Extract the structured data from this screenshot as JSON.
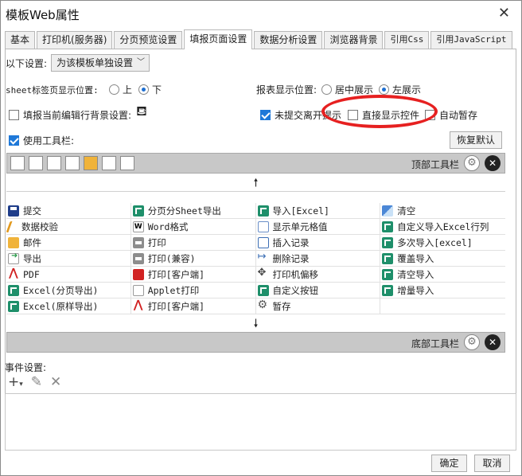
{
  "window": {
    "title": "模板Web属性"
  },
  "tabs": [
    {
      "label": "基本",
      "mono": false
    },
    {
      "label": "打印机(服务器)",
      "mono": false
    },
    {
      "label": "分页预览设置",
      "mono": false
    },
    {
      "label": "填报页面设置",
      "mono": false,
      "active": true
    },
    {
      "label": "数据分析设置",
      "mono": false
    },
    {
      "label": "浏览器背景",
      "mono": false
    },
    {
      "label": "引用Css",
      "mono": true
    },
    {
      "label": "引用JavaScript",
      "mono": true
    }
  ],
  "settings": {
    "scope_label": "以下设置:",
    "scope_value": "为该模板单独设置",
    "sheet_tab_label": "sheet标签页显示位置:",
    "sheet_top": "上",
    "sheet_bottom": "下",
    "report_pos_label": "报表显示位置:",
    "report_center": "居中展示",
    "report_left": "左展示",
    "fill_bg_label": "填报当前编辑行背景设置:",
    "unsubmitted_label": "未提交离开提示",
    "direct_show_label": "直接显示控件",
    "auto_save_label": "自动暂存",
    "use_toolbar_label": "使用工具栏:",
    "restore_default": "恢复默认"
  },
  "toolbar": {
    "top_label": "顶部工具栏",
    "bottom_label": "底部工具栏"
  },
  "grid": [
    [
      {
        "icon": "save",
        "text": "提交"
      },
      {
        "icon": "green",
        "text": "分页分Sheet导出"
      },
      {
        "icon": "green",
        "text": "导入[Excel]"
      },
      {
        "icon": "eraser",
        "text": "清空"
      }
    ],
    [
      {
        "icon": "check",
        "text": "数据校验"
      },
      {
        "icon": "word",
        "text": "Word格式"
      },
      {
        "icon": "cell",
        "text": "显示单元格值"
      },
      {
        "icon": "green",
        "text": "自定义导入Excel行列"
      }
    ],
    [
      {
        "icon": "mail",
        "text": "邮件"
      },
      {
        "icon": "print",
        "text": "打印"
      },
      {
        "icon": "insert",
        "text": "插入记录"
      },
      {
        "icon": "green",
        "text": "多次导入[excel]"
      }
    ],
    [
      {
        "icon": "export",
        "text": "导出"
      },
      {
        "icon": "print",
        "text": "打印(兼容)"
      },
      {
        "icon": "del",
        "text": "删除记录"
      },
      {
        "icon": "green",
        "text": "覆盖导入"
      }
    ],
    [
      {
        "icon": "pdf",
        "text": "PDF"
      },
      {
        "icon": "red",
        "text": "打印[客户端]"
      },
      {
        "icon": "move",
        "text": "打印机偏移"
      },
      {
        "icon": "green",
        "text": "清空导入"
      }
    ],
    [
      {
        "icon": "green",
        "text": "Excel(分页导出)"
      },
      {
        "icon": "applet",
        "text": "Applet打印"
      },
      {
        "icon": "green",
        "text": "自定义按钮"
      },
      {
        "icon": "green",
        "text": "增量导入"
      }
    ],
    [
      {
        "icon": "green",
        "text": "Excel(原样导出)"
      },
      {
        "icon": "pdf",
        "text": "打印[客户端]"
      },
      {
        "icon": "gear",
        "text": "暂存"
      },
      {
        "icon": "",
        "text": ""
      }
    ]
  ],
  "events": {
    "label": "事件设置:"
  },
  "footer": {
    "ok": "确定",
    "cancel": "取消"
  }
}
